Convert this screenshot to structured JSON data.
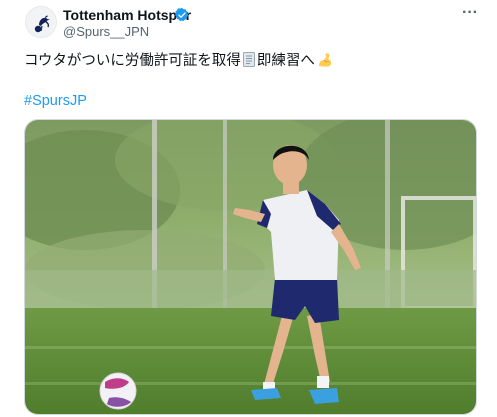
{
  "tweet": {
    "author_name": "Tottenham Hotspur",
    "handle": "@Spurs__JPN",
    "text_part1": "コウタがついに労働許可証を取得",
    "text_part2": "即練習へ",
    "hashtag": "#SpursJP",
    "icons": {
      "avatar": "spurs-crest-icon",
      "verified": "verified-badge-icon",
      "more": "more-options-icon",
      "document": "document-emoji-icon",
      "muscle": "flexed-biceps-emoji-icon"
    },
    "more_glyph": "···"
  },
  "colors": {
    "link": "#1d9bf0",
    "secondary_text": "#536471",
    "verified": "#1d9bf0"
  }
}
